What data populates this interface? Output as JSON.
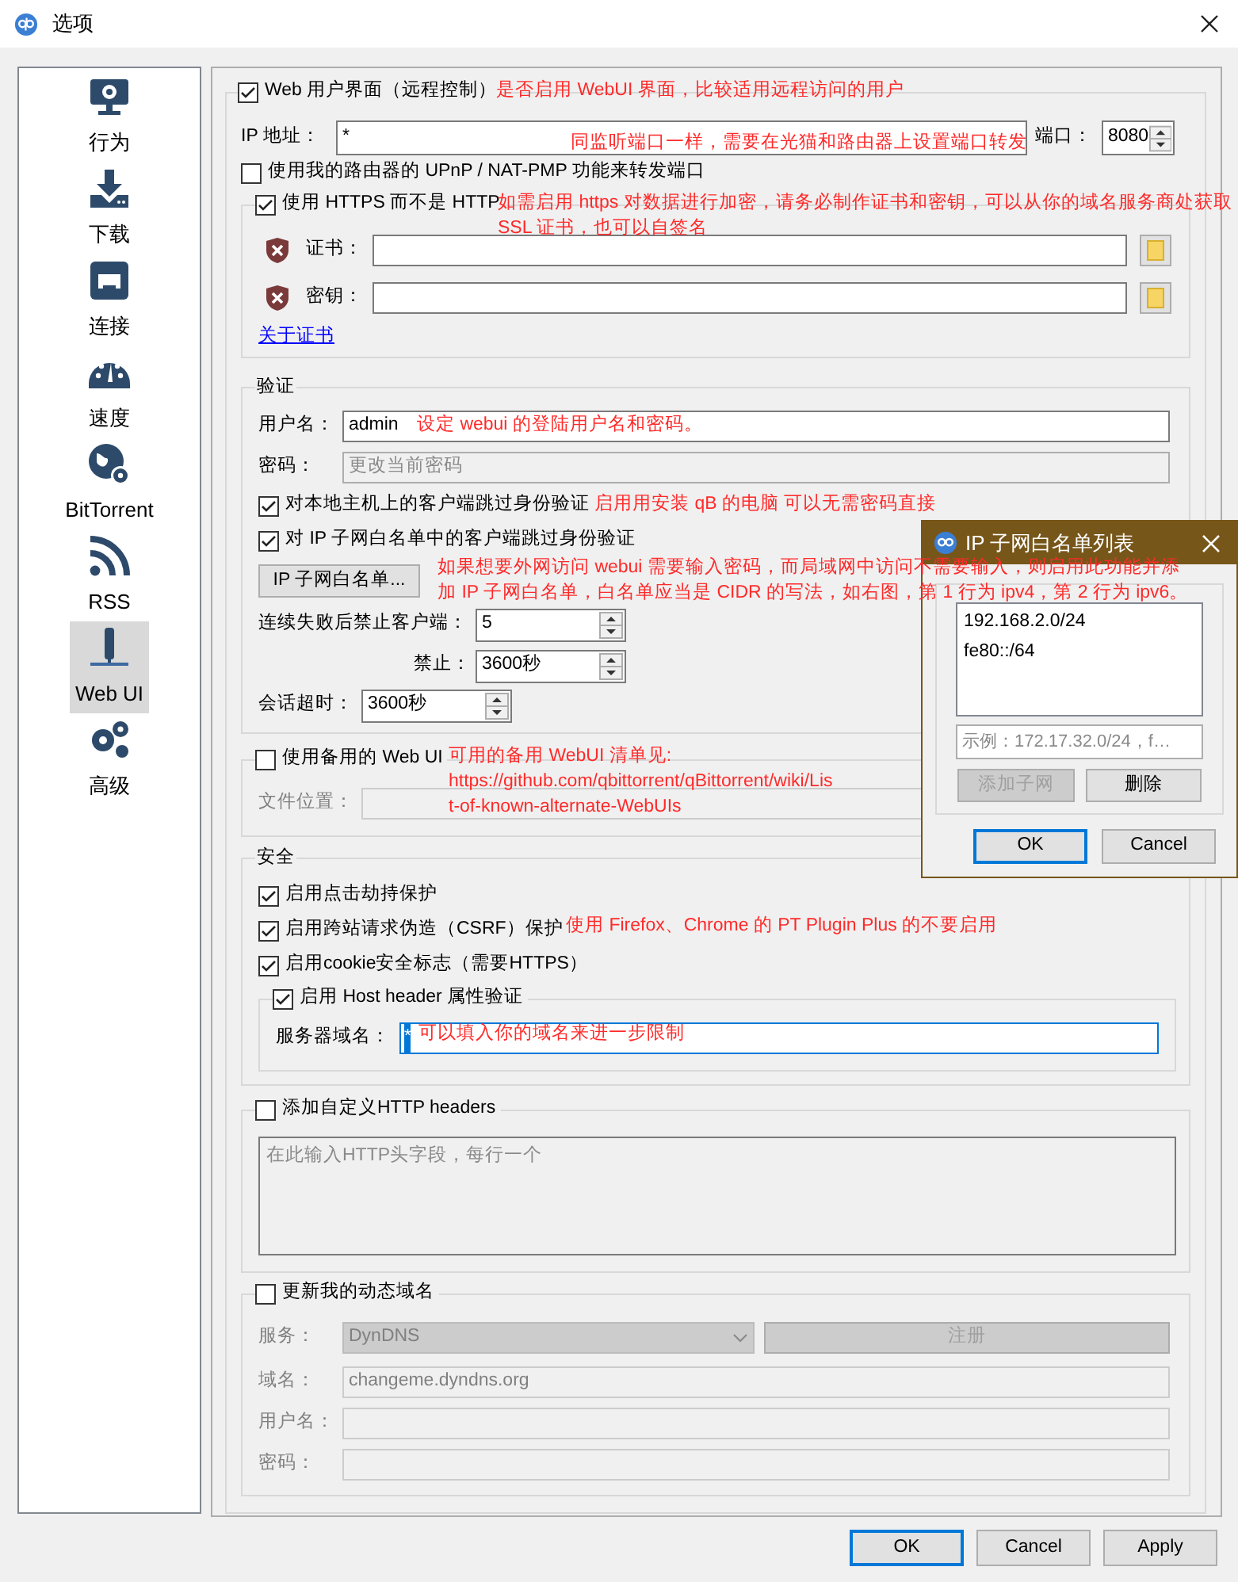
{
  "window": {
    "title": "选项"
  },
  "sidebar": {
    "items": [
      {
        "label": "行为",
        "selected": false
      },
      {
        "label": "下载",
        "selected": false
      },
      {
        "label": "连接",
        "selected": false
      },
      {
        "label": "速度",
        "selected": false
      },
      {
        "label": "BitTorrent",
        "selected": false
      },
      {
        "label": "RSS",
        "selected": false
      },
      {
        "label": "Web UI",
        "selected": true
      },
      {
        "label": "高级",
        "selected": false
      }
    ]
  },
  "webui": {
    "label": "Web 用户界面（远程控制）",
    "checked": true,
    "ip_label": "IP 地址：",
    "ip_value": "*",
    "port_label": "端口：",
    "port_value": "8080",
    "upnp": {
      "label": "使用我的路由器的 UPnP / NAT-PMP 功能来转发端口",
      "checked": false
    },
    "https": {
      "label": "使用 HTTPS 而不是 HTTP",
      "checked": true,
      "cert_label": "证书：",
      "key_label": "密钥：",
      "link": "关于证书"
    }
  },
  "authentication": {
    "title": "验证",
    "username_label": "用户名：",
    "username": "admin",
    "password_label": "密码：",
    "password_placeholder": "更改当前密码",
    "bypass_local": {
      "label": "对本地主机上的客户端跳过身份验证",
      "checked": true
    },
    "bypass_whitelist": {
      "label": "对 IP 子网白名单中的客户端跳过身份验证",
      "checked": true
    },
    "whitelist_button": "IP 子网白名单...",
    "ban_after_label": "连续失败后禁止客户端：",
    "ban_after": "5",
    "ban_for_label": "禁止：",
    "ban_for": "3600秒",
    "session_timeout_label": "会话超时：",
    "session_timeout": "3600秒"
  },
  "alternate_webui": {
    "label": "使用备用的 Web UI",
    "checked": false,
    "location_label": "文件位置："
  },
  "security": {
    "title": "安全",
    "options": [
      {
        "label": "启用点击劫持保护",
        "checked": true
      },
      {
        "label": "启用跨站请求伪造（CSRF）保护",
        "checked": true
      },
      {
        "label": "启用cookie安全标志（需要HTTPS）",
        "checked": true
      }
    ],
    "host_header": {
      "label": "启用 Host header 属性验证",
      "checked": true,
      "domains_label": "服务器域名：",
      "domains": "*",
      "focused": true
    }
  },
  "custom_headers": {
    "label": "添加自定义HTTP headers",
    "checked": false,
    "placeholder": "在此输入HTTP头字段，每行一个"
  },
  "dyndns": {
    "label": "更新我的动态域名",
    "checked": false,
    "service_label": "服务：",
    "service": "DynDNS",
    "register": "注册",
    "domain_label": "域名：",
    "domain": "changeme.dyndns.org",
    "username_label": "用户名：",
    "password_label": "密码："
  },
  "buttons": [
    {
      "label": "OK",
      "default": true
    },
    {
      "label": "Cancel",
      "default": false
    },
    {
      "label": "Apply",
      "default": false
    }
  ],
  "whitelist_dialog": {
    "title": "IP 子网白名单列表",
    "entries": [
      "192.168.2.0/24",
      "fe80::/64"
    ],
    "input_placeholder": "示例：172.17.32.0/24，f…",
    "add_button": {
      "label": "添加子网",
      "disabled": true
    },
    "delete_button": {
      "label": "删除",
      "disabled": false
    },
    "buttons": [
      {
        "label": "OK",
        "default": true
      },
      {
        "label": "Cancel",
        "default": false
      }
    ]
  },
  "annotations": [
    {
      "lines": [
        "是否启用 WebUI 界面，比较适用远程访问的用户"
      ]
    },
    {
      "lines": [
        "同监听端口一样，需要在光猫和路由器上设置端口转发"
      ]
    },
    {
      "lines": [
        "如需启用 https 对数据进行加密，请务必制作证书和密钥，可以从你的域名服务商处获取",
        "SSL 证书，也可以自签名"
      ]
    },
    {
      "lines": [
        "设定 webui 的登陆用户名和密码。"
      ]
    },
    {
      "lines": [
        "启用用安装 qB 的电脑 可以无需密码直接"
      ]
    },
    {
      "lines": [
        "如果想要外网访问 webui 需要输入密码，而局域网中访问不需要输入，则启用此功能并添",
        "加 IP 子网白名单，白名单应当是 CIDR 的写法，如右图，第 1 行为 ipv4，第 2 行为 ipv6。"
      ]
    },
    {
      "lines": [
        "可用的备用 WebUI 清单见:",
        "https://github.com/qbittorrent/qBittorrent/wiki/Lis",
        "t-of-known-alternate-WebUIs"
      ]
    },
    {
      "lines": [
        "使用 Firefox、Chrome 的 PT Plugin Plus 的不要启用"
      ]
    },
    {
      "lines": [
        "可以填入你的域名来进一步限制"
      ]
    }
  ]
}
